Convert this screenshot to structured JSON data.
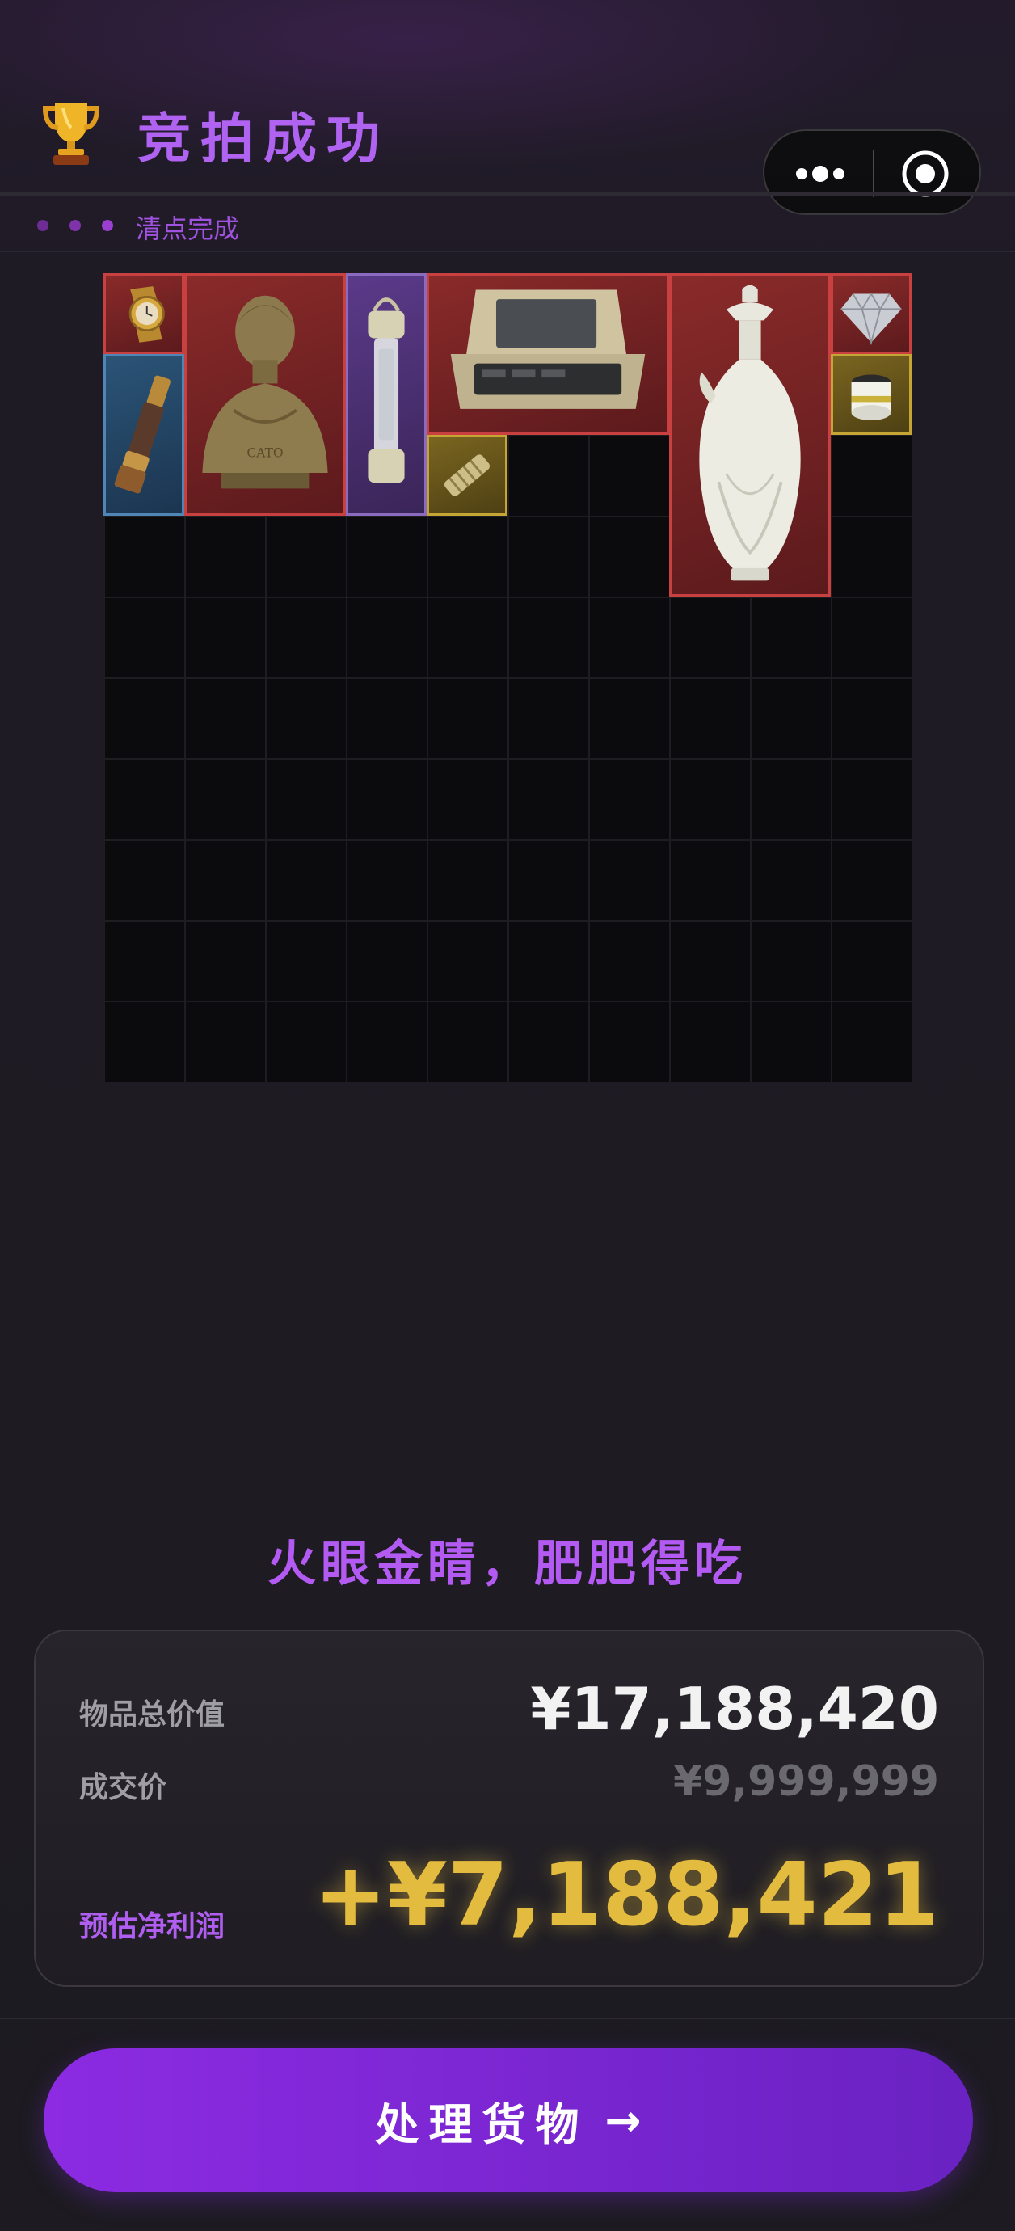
{
  "header": {
    "title": "竞拍成功",
    "status": "清点完成",
    "trophy_icon": "trophy-icon",
    "more_icon": "more-dots-icon",
    "close_icon": "target-circle-icon"
  },
  "inventory": {
    "grid_columns": 10,
    "grid_rows": 10,
    "items": [
      {
        "name": "gold-watch",
        "rarity": "red"
      },
      {
        "name": "telescope",
        "rarity": "blue"
      },
      {
        "name": "bronze-bust",
        "rarity": "red",
        "engraving": "CATO"
      },
      {
        "name": "lantern",
        "rarity": "purple"
      },
      {
        "name": "rugged-laptop-case",
        "rarity": "red"
      },
      {
        "name": "cable-roll",
        "rarity": "gold"
      },
      {
        "name": "porcelain-vase",
        "rarity": "red"
      },
      {
        "name": "diamond",
        "rarity": "red"
      },
      {
        "name": "filter-canister",
        "rarity": "gold"
      }
    ],
    "rarity_colors": {
      "red": "#c94040",
      "blue": "#4f86b5",
      "purple": "#8b6bc0",
      "gold": "#c5a534"
    }
  },
  "slogan": "火眼金睛，肥肥得吃",
  "summary": {
    "total_label": "物品总价值",
    "total_value": "¥17,188,420",
    "deal_label": "成交价",
    "deal_value": "¥9,999,999",
    "profit_label": "预估净利润",
    "profit_value": "+¥7,188,421"
  },
  "cta": {
    "label": "处理货物",
    "arrow": "→"
  },
  "colors": {
    "accent_purple": "#b062f0",
    "profit_gold": "#e3bb3e",
    "background": "#1d1b21"
  }
}
